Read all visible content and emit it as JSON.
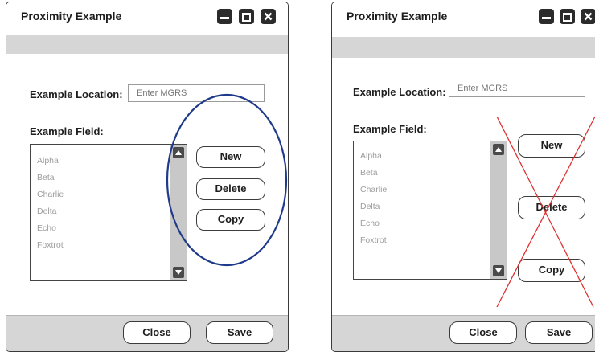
{
  "windows": [
    {
      "title": "Proximity Example",
      "location_label": "Example Location:",
      "location_placeholder": "Enter MGRS",
      "field_label": "Example Field:",
      "items": [
        "Alpha",
        "Beta",
        "Charlie",
        "Delta",
        "Echo",
        "Foxtrot"
      ],
      "new_label": "New",
      "delete_label": "Delete",
      "copy_label": "Copy",
      "close_label": "Close",
      "save_label": "Save"
    },
    {
      "title": "Proximity Example",
      "location_label": "Example Location:",
      "location_placeholder": "Enter MGRS",
      "field_label": "Example Field:",
      "items": [
        "Alpha",
        "Beta",
        "Charlie",
        "Delta",
        "Echo",
        "Foxtrot"
      ],
      "new_label": "New",
      "delete_label": "Delete",
      "copy_label": "Copy",
      "close_label": "Close",
      "save_label": "Save"
    }
  ],
  "annotations": {
    "circle_color": "#1f3a8a",
    "cross_color": "#e03030"
  },
  "icons": [
    "minimize-icon",
    "maximize-icon",
    "close-icon",
    "scroll-up-arrow-icon",
    "scroll-down-arrow-icon"
  ]
}
